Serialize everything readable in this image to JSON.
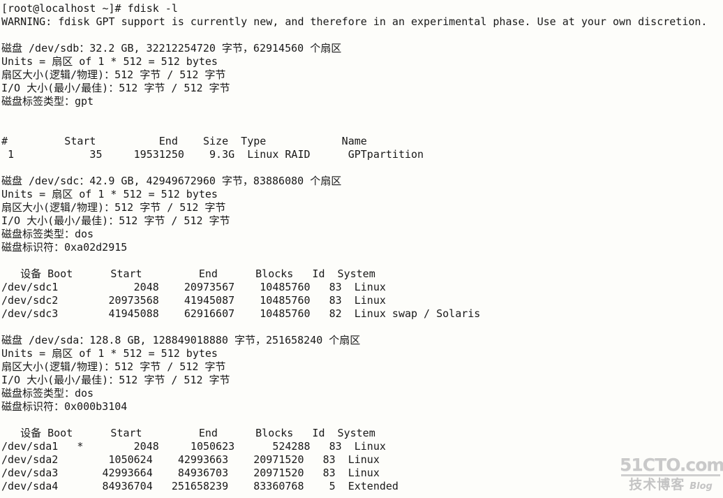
{
  "terminal": {
    "prompt_line": "[root@localhost ~]# fdisk -l",
    "warning": "WARNING: fdisk GPT support is currently new, and therefore in an experimental phase. Use at your own discretion.",
    "disks": [
      {
        "summary": "磁盘 /dev/sdb：32.2 GB, 32212254720 字节，62914560 个扇区",
        "units": "Units = 扇区 of 1 * 512 = 512 bytes",
        "sector_size": "扇区大小(逻辑/物理)：512 字节 / 512 字节",
        "io_size": "I/O 大小(最小/最佳)：512 字节 / 512 字节",
        "label_type": "磁盘标签类型：gpt",
        "identifier": null,
        "table_kind": "gpt",
        "header": "#         Start          End    Size  Type            Name",
        "rows": [
          " 1            35     19531250    9.3G  Linux RAID      GPTpartition"
        ]
      },
      {
        "summary": "磁盘 /dev/sdc：42.9 GB, 42949672960 字节，83886080 个扇区",
        "units": "Units = 扇区 of 1 * 512 = 512 bytes",
        "sector_size": "扇区大小(逻辑/物理)：512 字节 / 512 字节",
        "io_size": "I/O 大小(最小/最佳)：512 字节 / 512 字节",
        "label_type": "磁盘标签类型：dos",
        "identifier": "磁盘标识符：0xa02d2915",
        "table_kind": "dos",
        "header": "   设备 Boot      Start         End      Blocks   Id  System",
        "rows": [
          "/dev/sdc1            2048    20973567    10485760   83  Linux",
          "/dev/sdc2        20973568    41945087    10485760   83  Linux",
          "/dev/sdc3        41945088    62916607    10485760   82  Linux swap / Solaris"
        ]
      },
      {
        "summary": "磁盘 /dev/sda：128.8 GB, 128849018880 字节，251658240 个扇区",
        "units": "Units = 扇区 of 1 * 512 = 512 bytes",
        "sector_size": "扇区大小(逻辑/物理)：512 字节 / 512 字节",
        "io_size": "I/O 大小(最小/最佳)：512 字节 / 512 字节",
        "label_type": "磁盘标签类型：dos",
        "identifier": "磁盘标识符：0x000b3104",
        "table_kind": "dos",
        "header": "   设备 Boot      Start         End      Blocks   Id  System",
        "rows": [
          "/dev/sda1   *        2048     1050623      524288   83  Linux",
          "/dev/sda2        1050624    42993663    20971520   83  Linux",
          "/dev/sda3       42993664    84936703    20971520   83  Linux",
          "/dev/sda4       84936704   251658239    83360768    5  Extended"
        ]
      }
    ]
  },
  "watermark": {
    "site": "51CTO.com",
    "cn_text": "技术博客",
    "blog_text": "Blog"
  },
  "colors": {
    "background": "#fdfdfa",
    "text": "#181818",
    "watermark": "#c6c6c6"
  }
}
